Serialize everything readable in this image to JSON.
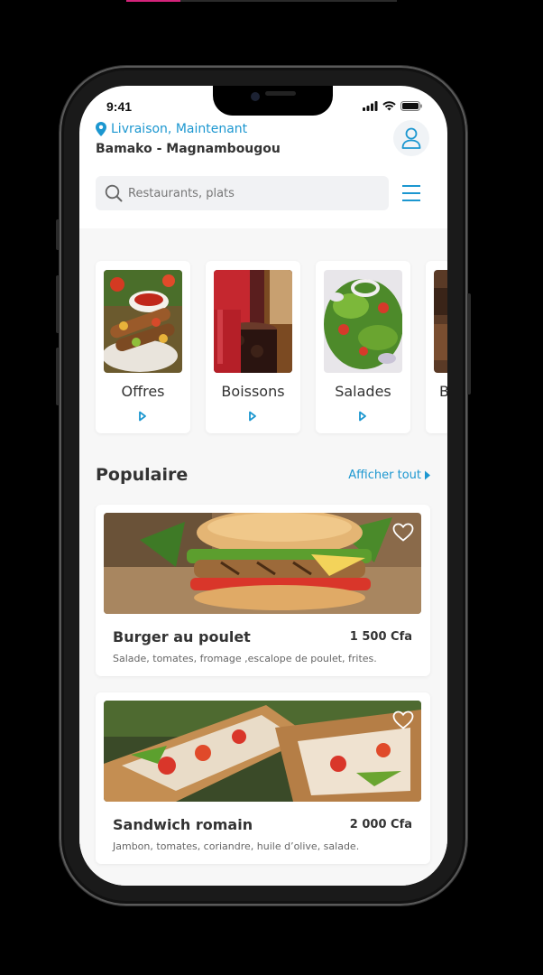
{
  "status_bar": {
    "time": "9:41"
  },
  "header": {
    "delivery_label": "Livraison, Maintenant",
    "address": "Bamako - Magnambougou"
  },
  "search": {
    "placeholder": "Restaurants, plats"
  },
  "categories": [
    {
      "label": "Offres"
    },
    {
      "label": "Boissons"
    },
    {
      "label": "Salades"
    },
    {
      "label": "B"
    }
  ],
  "popular": {
    "title": "Populaire",
    "see_all": "Afficher tout",
    "items": [
      {
        "name": "Burger au poulet",
        "price": "1 500 Cfa",
        "description": "Salade, tomates, fromage ,escalope de poulet, frites."
      },
      {
        "name": "Sandwich romain",
        "price": "2 000 Cfa",
        "description": "Jambon, tomates, coriandre, huile d’olive, salade."
      }
    ]
  },
  "colors": {
    "accent": "#1c97d0",
    "text": "#333333",
    "background": "#f7f7f7"
  }
}
